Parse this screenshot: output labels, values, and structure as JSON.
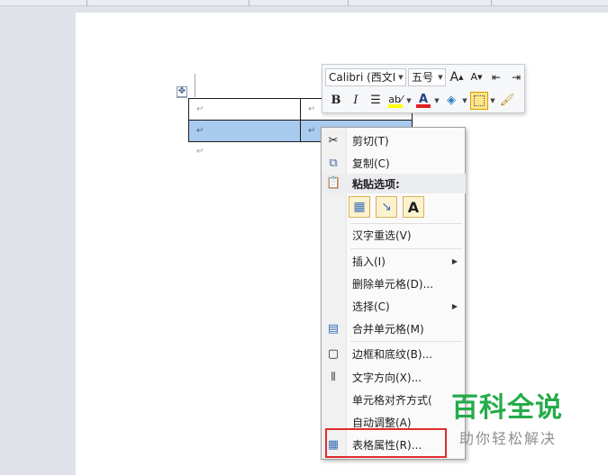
{
  "mini_toolbar": {
    "font_name": "Calibri (西文Ⅰ",
    "font_size": "五号",
    "icons": [
      "grow-font-icon",
      "shrink-font-icon",
      "decrease-indent-icon",
      "increase-indent-icon",
      "bold-icon",
      "italic-icon",
      "center-align-icon",
      "highlight-icon",
      "font-color-icon",
      "shading-icon",
      "borders-icon",
      "format-painter-icon"
    ],
    "bold_label": "B",
    "italic_label": "I",
    "font_color_label": "A",
    "grow_label": "A",
    "shrink_label": "A"
  },
  "table": {
    "cell_mark": "↵",
    "paragraph_mark": "↵"
  },
  "context_menu": {
    "cut": "剪切(T)",
    "copy": "复制(C)",
    "paste_options": "粘贴选项:",
    "reconvert": "汉字重选(V)",
    "insert": "插入(I)",
    "delete_cells": "删除单元格(D)...",
    "select": "选择(C)",
    "merge_cells": "合并单元格(M)",
    "borders_shading": "边框和底纹(B)...",
    "text_direction": "文字方向(X)...",
    "cell_alignment": "单元格对齐方式(",
    "autofit": "自动调整(A)",
    "table_properties": "表格属性(R)...",
    "paste_keep_text_label": "A"
  },
  "watermark": {
    "title": "百科全说",
    "subtitle": "助你轻松解决"
  },
  "colors": {
    "highlight_red": "#e02c2c",
    "watermark_green": "#25ab4a",
    "selection_blue": "#a9cbee"
  }
}
